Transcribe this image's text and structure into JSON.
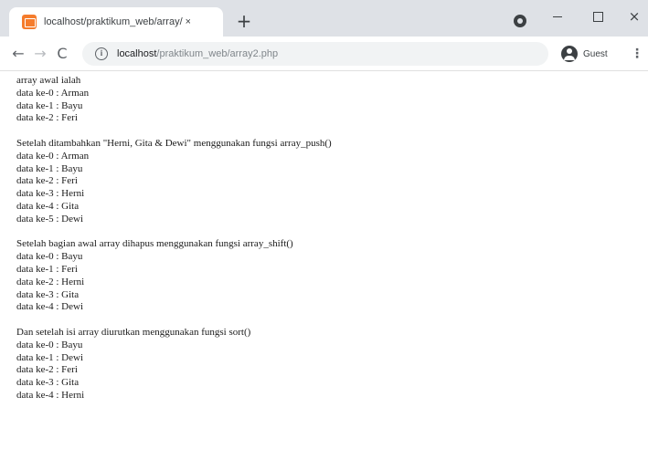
{
  "browser": {
    "tab_title": "localhost/praktikum_web/array/ ×",
    "tab_close": "×",
    "new_tab": "+",
    "url_host": "localhost",
    "url_path": "/praktikum_web/array2.php",
    "profile_label": "Guest",
    "menu": "⋮",
    "back": "←",
    "forward": "→",
    "reload": "C",
    "info": "i",
    "window_close": "×"
  },
  "page": {
    "sections": [
      {
        "heading": "array awal ialah",
        "lines": [
          "data ke-0 : Arman",
          "data ke-1 : Bayu",
          "data ke-2 : Feri"
        ]
      },
      {
        "heading": "Setelah ditambahkan \"Herni, Gita & Dewi\" menggunakan fungsi array_push()",
        "lines": [
          "data ke-0 : Arman",
          "data ke-1 : Bayu",
          "data ke-2 : Feri",
          "data ke-3 : Herni",
          "data ke-4 : Gita",
          "data ke-5 : Dewi"
        ]
      },
      {
        "heading": "Setelah bagian awal array dihapus menggunakan fungsi array_shift()",
        "lines": [
          "data ke-0 : Bayu",
          "data ke-1 : Feri",
          "data ke-2 : Herni",
          "data ke-3 : Gita",
          "data ke-4 : Dewi"
        ]
      },
      {
        "heading": "Dan setelah isi array diurutkan menggunakan fungsi sort()",
        "lines": [
          "data ke-0 : Bayu",
          "data ke-1 : Dewi",
          "data ke-2 : Feri",
          "data ke-3 : Gita",
          "data ke-4 : Herni"
        ]
      }
    ]
  }
}
